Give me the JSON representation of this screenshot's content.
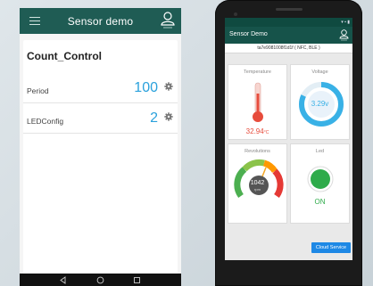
{
  "left_app": {
    "title": "Sensor demo",
    "card_title": "Count_Control",
    "rows": [
      {
        "label": "Period",
        "value": "100"
      },
      {
        "label": "LEDConfig",
        "value": "2"
      }
    ]
  },
  "phone_app": {
    "title": "Sensor Demo",
    "device_id": "ta7e9081008f1d1f ( NFC, BLE )",
    "tiles": {
      "temperature": {
        "title": "Temperature",
        "value": "32.94",
        "unit": "°C"
      },
      "voltage": {
        "title": "Voltage",
        "value": "3.29v",
        "fraction": 0.82
      },
      "revolutions": {
        "title": "Revolutions",
        "value": "1042",
        "unit": "rpm"
      },
      "led": {
        "title": "Led",
        "value": "ON"
      }
    },
    "cloud_button": "Cloud Service"
  },
  "colors": {
    "left_appbar": "#1f5c54",
    "phone_appbar": "#16534a",
    "value_blue": "#2aa1dc",
    "temp_red": "#e74c3c",
    "led_green": "#2eab4a",
    "cloud_blue": "#1e88e5"
  },
  "icons": {
    "menu": "hamburger-icon",
    "user": "user-icon",
    "settings": "gear-icon",
    "nav_back": "back-triangle-icon",
    "nav_home": "home-circle-icon",
    "nav_recent": "recent-square-icon"
  }
}
